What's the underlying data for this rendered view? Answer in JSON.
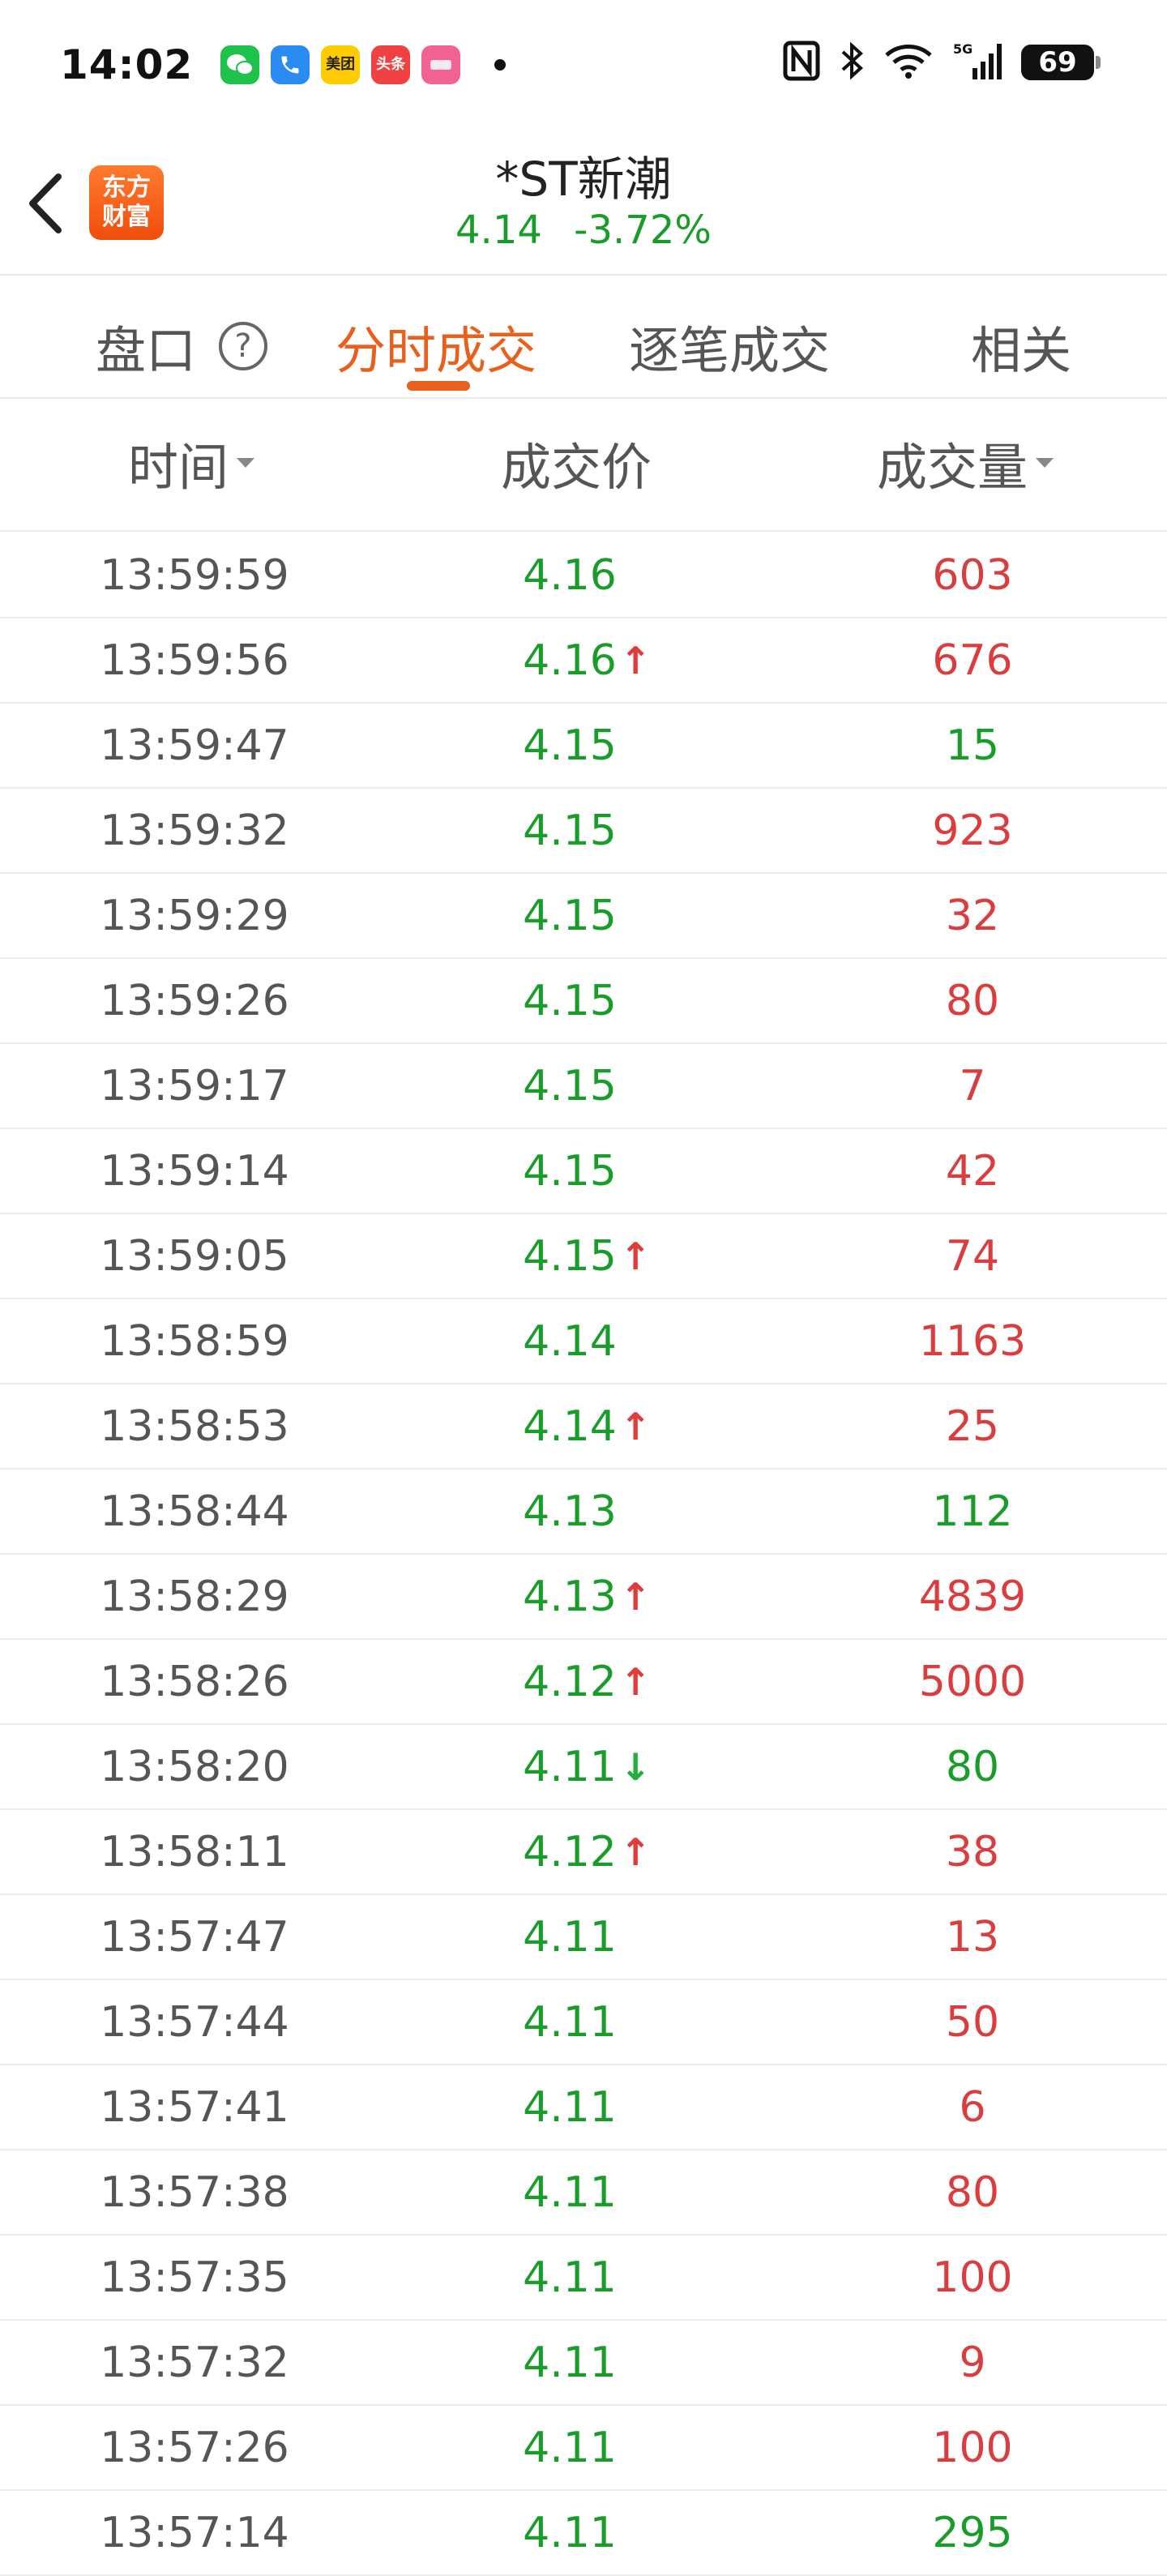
{
  "status_bar": {
    "time": "14:02",
    "battery": "69",
    "notification_apps": [
      {
        "icon": "wechat-icon",
        "color": "#1fc24b",
        "label": ""
      },
      {
        "icon": "phone-icon",
        "color": "#2a8cf0",
        "label": ""
      },
      {
        "icon": "meituan-icon",
        "color": "#ffcc00",
        "label": "美团"
      },
      {
        "icon": "toutiao-icon",
        "color": "#f04142",
        "label": "头条"
      },
      {
        "icon": "app-icon",
        "color": "#f06292",
        "label": ""
      }
    ],
    "system_icons": [
      "nfc-icon",
      "bluetooth-icon",
      "wifi-icon",
      "5g-signal-icon",
      "battery-icon"
    ]
  },
  "header": {
    "logo_text_line1": "东方",
    "logo_text_line2": "财富",
    "stock_name": "*ST新潮",
    "price": "4.14",
    "change_pct": "-3.72%"
  },
  "tabs": [
    {
      "label": "盘口",
      "active": false
    },
    {
      "label": "分时成交",
      "active": true
    },
    {
      "label": "逐笔成交",
      "active": false
    },
    {
      "label": "相关",
      "active": false
    }
  ],
  "columns": {
    "time": "时间",
    "price": "成交价",
    "volume": "成交量"
  },
  "colors": {
    "accent": "#e8601c",
    "up_red": "#d93d3d",
    "down_green": "#1a9c2b"
  },
  "rows": [
    {
      "time": "13:59:59",
      "price": "4.16",
      "arrow": "",
      "volume": "603",
      "vol_color": "red"
    },
    {
      "time": "13:59:56",
      "price": "4.16",
      "arrow": "up",
      "volume": "676",
      "vol_color": "red"
    },
    {
      "time": "13:59:47",
      "price": "4.15",
      "arrow": "",
      "volume": "15",
      "vol_color": "green"
    },
    {
      "time": "13:59:32",
      "price": "4.15",
      "arrow": "",
      "volume": "923",
      "vol_color": "red"
    },
    {
      "time": "13:59:29",
      "price": "4.15",
      "arrow": "",
      "volume": "32",
      "vol_color": "red"
    },
    {
      "time": "13:59:26",
      "price": "4.15",
      "arrow": "",
      "volume": "80",
      "vol_color": "red"
    },
    {
      "time": "13:59:17",
      "price": "4.15",
      "arrow": "",
      "volume": "7",
      "vol_color": "red"
    },
    {
      "time": "13:59:14",
      "price": "4.15",
      "arrow": "",
      "volume": "42",
      "vol_color": "red"
    },
    {
      "time": "13:59:05",
      "price": "4.15",
      "arrow": "up",
      "volume": "74",
      "vol_color": "red"
    },
    {
      "time": "13:58:59",
      "price": "4.14",
      "arrow": "",
      "volume": "1163",
      "vol_color": "red"
    },
    {
      "time": "13:58:53",
      "price": "4.14",
      "arrow": "up",
      "volume": "25",
      "vol_color": "red"
    },
    {
      "time": "13:58:44",
      "price": "4.13",
      "arrow": "",
      "volume": "112",
      "vol_color": "green"
    },
    {
      "time": "13:58:29",
      "price": "4.13",
      "arrow": "up",
      "volume": "4839",
      "vol_color": "red"
    },
    {
      "time": "13:58:26",
      "price": "4.12",
      "arrow": "up",
      "volume": "5000",
      "vol_color": "red"
    },
    {
      "time": "13:58:20",
      "price": "4.11",
      "arrow": "down",
      "volume": "80",
      "vol_color": "green"
    },
    {
      "time": "13:58:11",
      "price": "4.12",
      "arrow": "up",
      "volume": "38",
      "vol_color": "red"
    },
    {
      "time": "13:57:47",
      "price": "4.11",
      "arrow": "",
      "volume": "13",
      "vol_color": "red"
    },
    {
      "time": "13:57:44",
      "price": "4.11",
      "arrow": "",
      "volume": "50",
      "vol_color": "red"
    },
    {
      "time": "13:57:41",
      "price": "4.11",
      "arrow": "",
      "volume": "6",
      "vol_color": "red"
    },
    {
      "time": "13:57:38",
      "price": "4.11",
      "arrow": "",
      "volume": "80",
      "vol_color": "red"
    },
    {
      "time": "13:57:35",
      "price": "4.11",
      "arrow": "",
      "volume": "100",
      "vol_color": "red"
    },
    {
      "time": "13:57:32",
      "price": "4.11",
      "arrow": "",
      "volume": "9",
      "vol_color": "red"
    },
    {
      "time": "13:57:26",
      "price": "4.11",
      "arrow": "",
      "volume": "100",
      "vol_color": "red"
    },
    {
      "time": "13:57:14",
      "price": "4.11",
      "arrow": "",
      "volume": "295",
      "vol_color": "green"
    }
  ]
}
